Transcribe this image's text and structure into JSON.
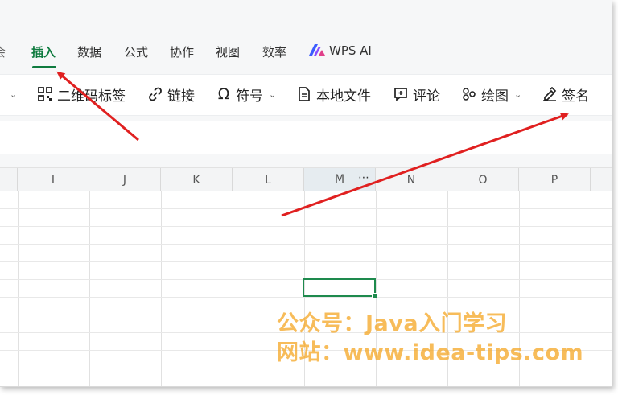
{
  "tabs": [
    {
      "label": "插入",
      "active": true
    },
    {
      "label": "数据"
    },
    {
      "label": "公式"
    },
    {
      "label": "协作"
    },
    {
      "label": "视图"
    },
    {
      "label": "效率"
    },
    {
      "label": "WPS AI"
    }
  ],
  "toolbar": {
    "qrcode_label": "二维码标签",
    "link_label": "链接",
    "symbol_label": "符号",
    "local_file_label": "本地文件",
    "comment_label": "评论",
    "drawing_label": "绘图",
    "signature_label": "签名"
  },
  "columns": [
    "I",
    "J",
    "K",
    "L",
    "M",
    "N",
    "O",
    "P"
  ],
  "selected_column": "M",
  "watermark": {
    "line1": "公众号：Java入门学习",
    "line2": "网站：www.idea-tips.com"
  },
  "colors": {
    "accent": "#0f7b3f",
    "arrow": "#e02020",
    "watermark": "#f5a623"
  }
}
